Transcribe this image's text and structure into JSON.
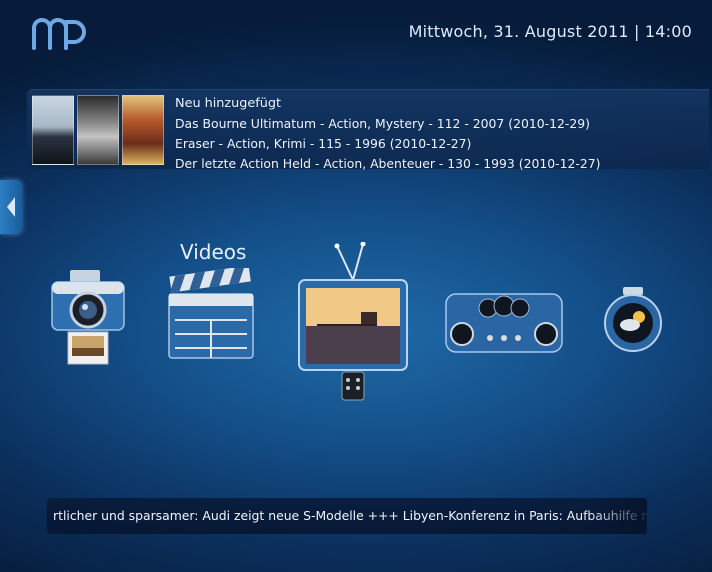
{
  "header": {
    "datetime": "Mittwoch, 31. August 2011 | 14:00",
    "logo_icon": "mediaportal-logo"
  },
  "recently_added": {
    "title": "Neu hinzugefügt",
    "items": [
      "Das Bourne Ultimatum - Action, Mystery - 112 - 2007  (2010-12-29)",
      "Eraser - Action, Krimi - 115 - 1996  (2010-12-27)",
      "Der letzte Action Held - Action, Abenteuer - 130 - 1993  (2010-12-27)"
    ]
  },
  "menu": {
    "focused_label": "Videos",
    "items": [
      {
        "icon": "camera-icon"
      },
      {
        "icon": "clapperboard-icon"
      },
      {
        "icon": "tv-icon"
      },
      {
        "icon": "dashboard-icon"
      },
      {
        "icon": "weather-icon"
      }
    ]
  },
  "ticker": {
    "text": "rtlicher und sparsamer: Audi zeigt neue S-Modelle +++ Libyen-Konferenz in Paris: Aufbauhilfe mit Gadd"
  },
  "colors": {
    "background": "#14508a",
    "accent": "#2c7fc3",
    "text": "#e8f0ff"
  }
}
